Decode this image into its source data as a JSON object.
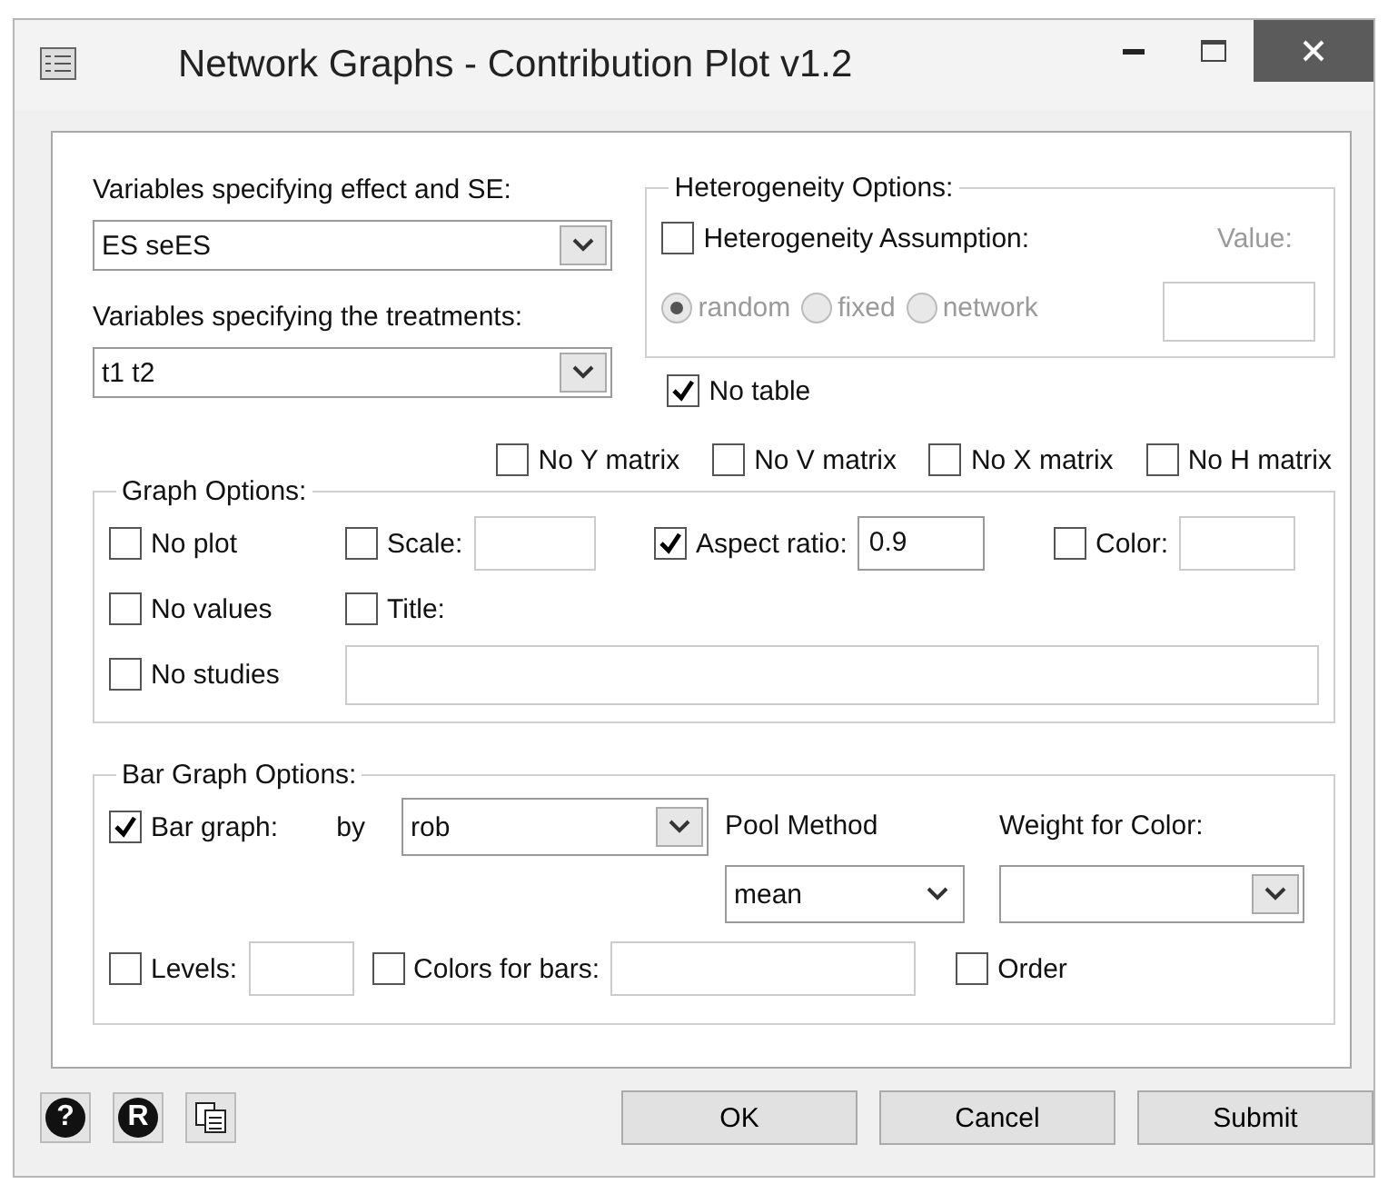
{
  "window": {
    "title": "Network Graphs - Contribution Plot v1.2"
  },
  "effect_vars": {
    "label": "Variables specifying effect and SE:",
    "value": "ES seES"
  },
  "treatment_vars": {
    "label": "Variables specifying the treatments:",
    "value": "t1 t2"
  },
  "heterogeneity": {
    "title": "Heterogeneity Options:",
    "assumption": {
      "label": "Heterogeneity Assumption:",
      "checked": false
    },
    "value_label": "Value:",
    "disabled": true,
    "radios": [
      {
        "label": "random",
        "selected": true
      },
      {
        "label": "fixed",
        "selected": false
      },
      {
        "label": "network",
        "selected": false
      }
    ]
  },
  "no_table": {
    "label": "No table",
    "checked": true
  },
  "matrix_options": [
    {
      "label": "No Y matrix",
      "checked": false
    },
    {
      "label": "No V matrix",
      "checked": false
    },
    {
      "label": "No X matrix",
      "checked": false
    },
    {
      "label": "No H matrix",
      "checked": false
    }
  ],
  "graph_options": {
    "title": "Graph Options:",
    "no_plot": {
      "label": "No plot",
      "checked": false
    },
    "scale": {
      "label": "Scale:",
      "checked": false
    },
    "aspect_ratio": {
      "label": "Aspect ratio:",
      "checked": true,
      "value": "0.9"
    },
    "color": {
      "label": "Color:",
      "checked": false
    },
    "no_values": {
      "label": "No values",
      "checked": false
    },
    "title_option": {
      "label": "Title:",
      "checked": false
    },
    "no_studies": {
      "label": "No studies",
      "checked": false
    }
  },
  "bar_graph_options": {
    "title": "Bar Graph Options:",
    "bar_graph": {
      "label": "Bar graph:",
      "checked": true
    },
    "by_label": "by",
    "by_value": "rob",
    "pool_label": "Pool Method",
    "pool_value": "mean",
    "weight_label": "Weight for Color:",
    "levels": {
      "label": "Levels:",
      "checked": false
    },
    "colors_for_bars": {
      "label": "Colors for bars:",
      "checked": false
    },
    "order": {
      "label": "Order",
      "checked": false
    }
  },
  "footer": {
    "help_icon": "?",
    "r_icon": "R",
    "buttons": [
      "OK",
      "Cancel",
      "Submit"
    ]
  }
}
